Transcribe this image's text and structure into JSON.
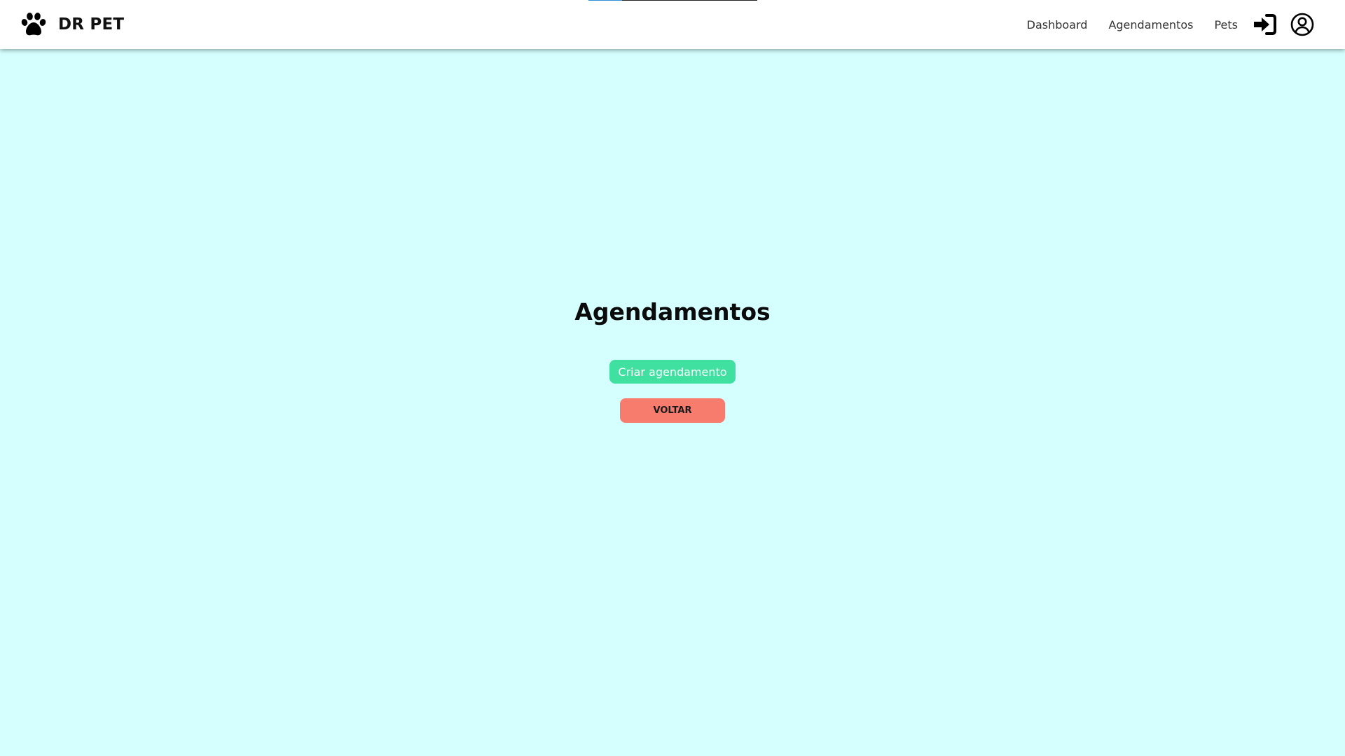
{
  "brand": {
    "name": "DR PET",
    "icon": "paw-icon"
  },
  "nav": {
    "links": [
      {
        "label": "Dashboard"
      },
      {
        "label": "Agendamentos"
      },
      {
        "label": "Pets"
      }
    ],
    "login_icon": "sign-in-icon",
    "user_icon": "user-circle-icon"
  },
  "page": {
    "title": "Agendamentos",
    "create_button_label": "Criar agendamento",
    "back_button_label": "VOLTAR"
  },
  "colors": {
    "background": "#d5ffff",
    "navbar": "#ffffff",
    "create_button": "#3fe0a0",
    "back_button": "#f77c6e",
    "progress_bar": "#2f8fd6"
  },
  "page_loading_progress": 0.2
}
